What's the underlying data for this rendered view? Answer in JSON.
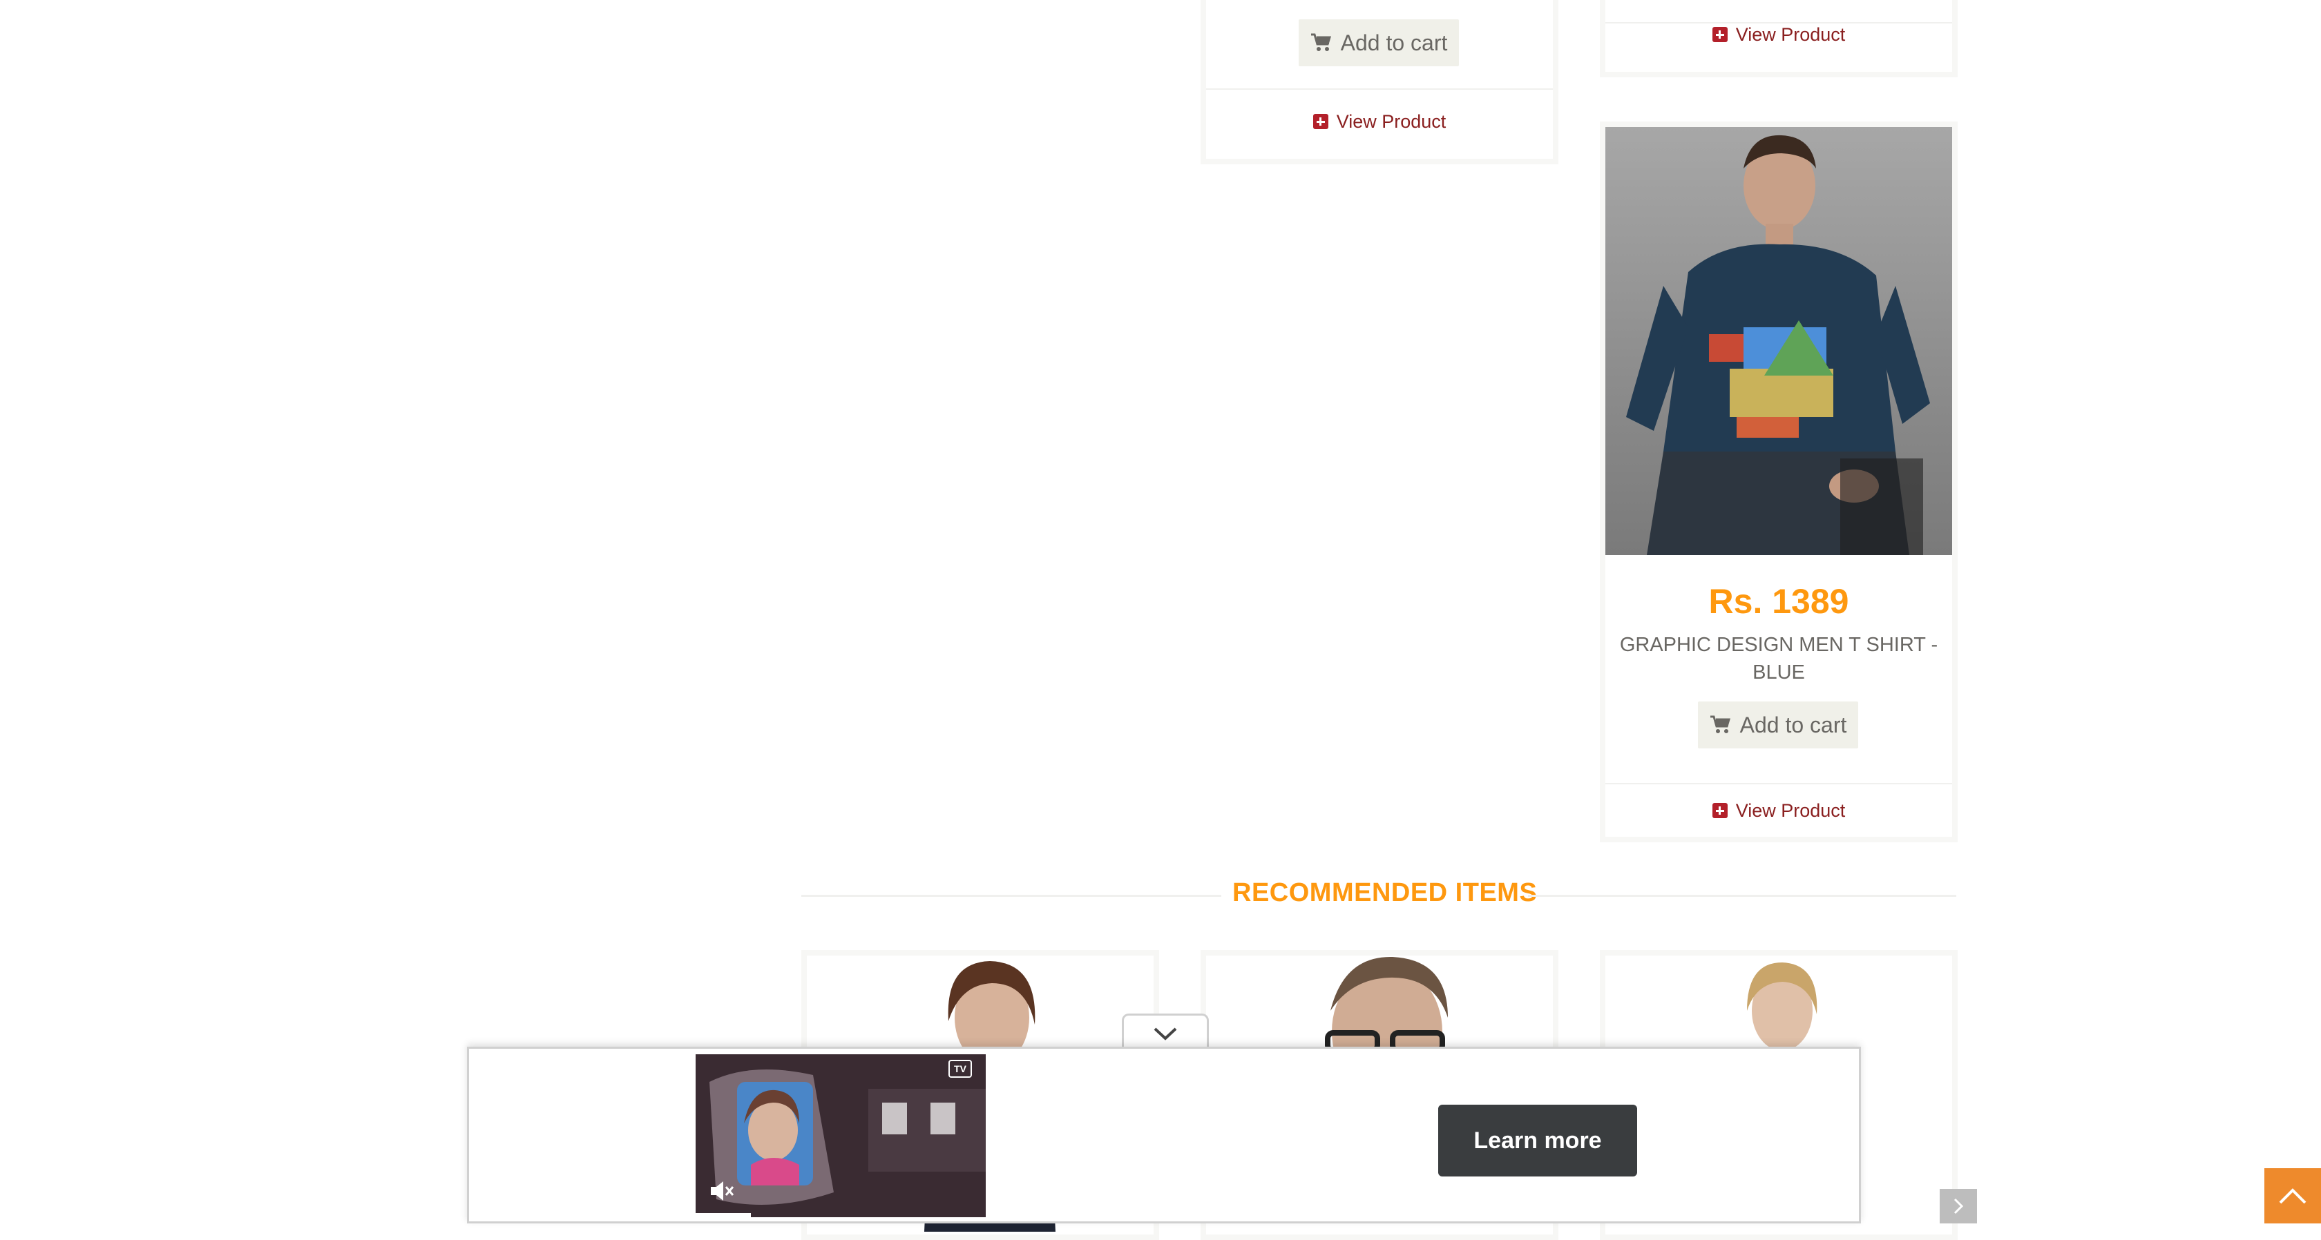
{
  "products": [
    {
      "add_to_cart_label": "Add to cart",
      "view_label": "View Product"
    },
    {
      "view_label": "View Product"
    },
    {
      "price": "Rs. 1389",
      "name": "GRAPHIC DESIGN MEN T SHIRT - BLUE",
      "add_to_cart_label": "Add to cart",
      "view_label": "View Product"
    }
  ],
  "recommended": {
    "title": "RECOMMENDED ITEMS"
  },
  "ad": {
    "cta_label": "Learn more",
    "video_badge": "TV"
  },
  "colors": {
    "accent": "#fe980f",
    "link": "#8a1f1f",
    "scroll_top_bg": "#ee8a2c",
    "ad_button_bg": "#3a3d3f"
  },
  "icons": [
    "cart-icon",
    "plus-square-icon",
    "chevron-down-icon",
    "mute-icon",
    "chevron-up-icon",
    "chevron-right-icon"
  ]
}
